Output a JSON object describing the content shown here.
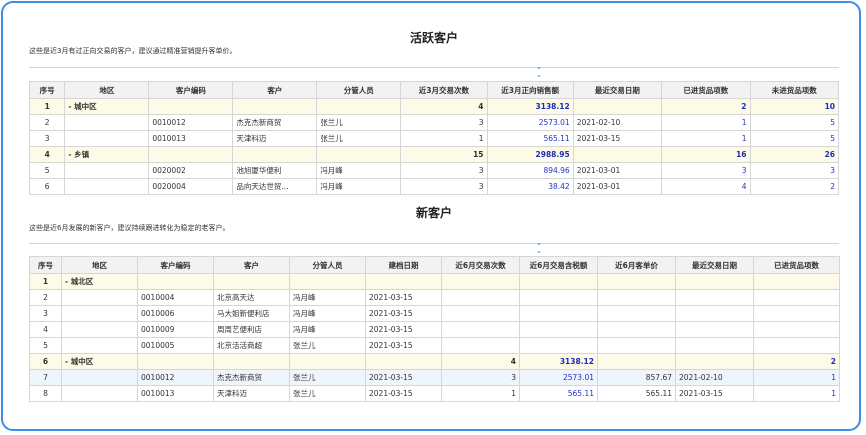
{
  "active": {
    "title": "活跃客户",
    "desc": "这些是近3月有过正向交易的客户，建议通过精准营销提升客单价。",
    "columns": [
      "序号",
      "地区",
      "客户编码",
      "客户",
      "分管人员",
      "近3月交易次数",
      "近3月正向销售额",
      "最近交易日期",
      "已进货品项数",
      "未进货品项数"
    ],
    "rows": [
      {
        "type": "group",
        "cells": [
          "1",
          "-  城中区",
          "",
          "",
          "",
          "4",
          "3138.12",
          "",
          "2",
          "10"
        ]
      },
      {
        "type": "row",
        "cells": [
          "2",
          "",
          "0010012",
          "杰克杰新商贸",
          "张兰儿",
          "3",
          "2573.01",
          "2021-02-10",
          "1",
          "5"
        ]
      },
      {
        "type": "row",
        "cells": [
          "3",
          "",
          "0010013",
          "天津科迈",
          "张兰儿",
          "1",
          "565.11",
          "2021-03-15",
          "1",
          "5"
        ]
      },
      {
        "type": "group",
        "cells": [
          "4",
          "-  乡镇",
          "",
          "",
          "",
          "15",
          "2988.95",
          "",
          "16",
          "26"
        ]
      },
      {
        "type": "row",
        "cells": [
          "5",
          "",
          "0020002",
          "池旭厦华便利",
          "冯月峰",
          "3",
          "894.96",
          "2021-03-01",
          "3",
          "3"
        ]
      },
      {
        "type": "row",
        "cells": [
          "6",
          "",
          "0020004",
          "品向天达世贸...",
          "冯月峰",
          "3",
          "38.42",
          "2021-03-01",
          "4",
          "2"
        ]
      }
    ]
  },
  "newc": {
    "title": "新客户",
    "desc": "这些是近6月发展的新客户，建议持续跟进转化为稳定的老客户。",
    "columns": [
      "序号",
      "地区",
      "客户编码",
      "客户",
      "分管人员",
      "建档日期",
      "近6月交易次数",
      "近6月交易含税额",
      "近6月客单价",
      "最近交易日期",
      "已进货品项数"
    ],
    "rows": [
      {
        "type": "group",
        "cells": [
          "1",
          "-  城北区",
          "",
          "",
          "",
          "",
          "",
          "",
          "",
          "",
          ""
        ]
      },
      {
        "type": "row",
        "cells": [
          "2",
          "",
          "0010004",
          "北京高天达",
          "冯月峰",
          "2021-03-15",
          "",
          "",
          "",
          "",
          ""
        ]
      },
      {
        "type": "row",
        "cells": [
          "3",
          "",
          "0010006",
          "马大姐新便利店",
          "冯月峰",
          "2021-03-15",
          "",
          "",
          "",
          "",
          ""
        ]
      },
      {
        "type": "row",
        "cells": [
          "4",
          "",
          "0010009",
          "周周艺便利店",
          "冯月峰",
          "2021-03-15",
          "",
          "",
          "",
          "",
          ""
        ]
      },
      {
        "type": "row",
        "cells": [
          "5",
          "",
          "0010005",
          "北京活活商超",
          "张兰儿",
          "2021-03-15",
          "",
          "",
          "",
          "",
          ""
        ]
      },
      {
        "type": "group",
        "cells": [
          "6",
          "-  城中区",
          "",
          "",
          "",
          "",
          "4",
          "3138.12",
          "",
          "",
          "2"
        ]
      },
      {
        "type": "hl",
        "cells": [
          "7",
          "",
          "0010012",
          "杰克杰新商贸",
          "张兰儿",
          "2021-03-15",
          "3",
          "2573.01",
          "857.67",
          "2021-02-10",
          "1"
        ]
      },
      {
        "type": "row",
        "cells": [
          "8",
          "",
          "0010013",
          "天津科迈",
          "张兰儿",
          "2021-03-15",
          "1",
          "565.11",
          "565.11",
          "2021-03-15",
          "1"
        ]
      }
    ]
  },
  "icons": {
    "chevron": "chevron-double-down-icon"
  },
  "colors": {
    "accent": "#3a8ee6",
    "number": "#2233cc",
    "group_bg": "#fdfbe8"
  }
}
